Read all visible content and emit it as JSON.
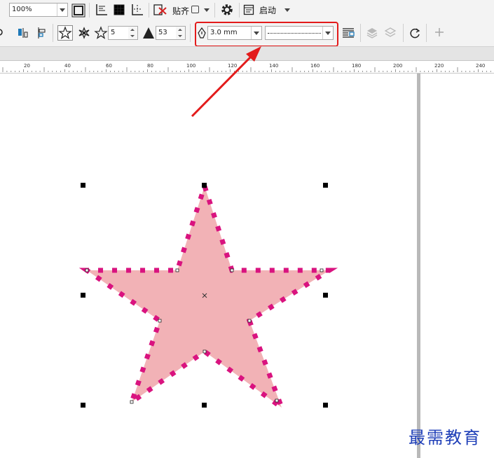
{
  "toolbar_top": {
    "zoom_value": "100%",
    "align_label": "贴齐",
    "launch_label": "启动",
    "icons": [
      "full-screen-icon",
      "rulers-icon",
      "grid-icon",
      "guidelines-icon",
      "snap-off-icon",
      "settings-icon",
      "launch-icon"
    ]
  },
  "property_bar": {
    "points_value": "5",
    "sharpness_value": "53",
    "outline_width": "3.0 mm",
    "line_style": "dotted",
    "icons": [
      "mirror-icon",
      "align-icon",
      "star-shape-icon",
      "complex-star-icon",
      "points-icon",
      "sharpness-icon",
      "outline-pen-icon",
      "wrap-text-icon",
      "front-icon",
      "back-icon",
      "convert-curve-icon",
      "add-icon"
    ]
  },
  "ruler": {
    "labels": [
      "20",
      "40",
      "60",
      "80",
      "100",
      "120",
      "140",
      "160",
      "180",
      "200",
      "220",
      "240"
    ]
  },
  "canvas": {
    "star": {
      "fill_color": "#f2b2b6",
      "outline_color": "#d9137f",
      "outline_style": "dotted"
    }
  },
  "annotation": {
    "highlight_color": "#e31b1b"
  },
  "watermark": {
    "text": "最需教育"
  }
}
